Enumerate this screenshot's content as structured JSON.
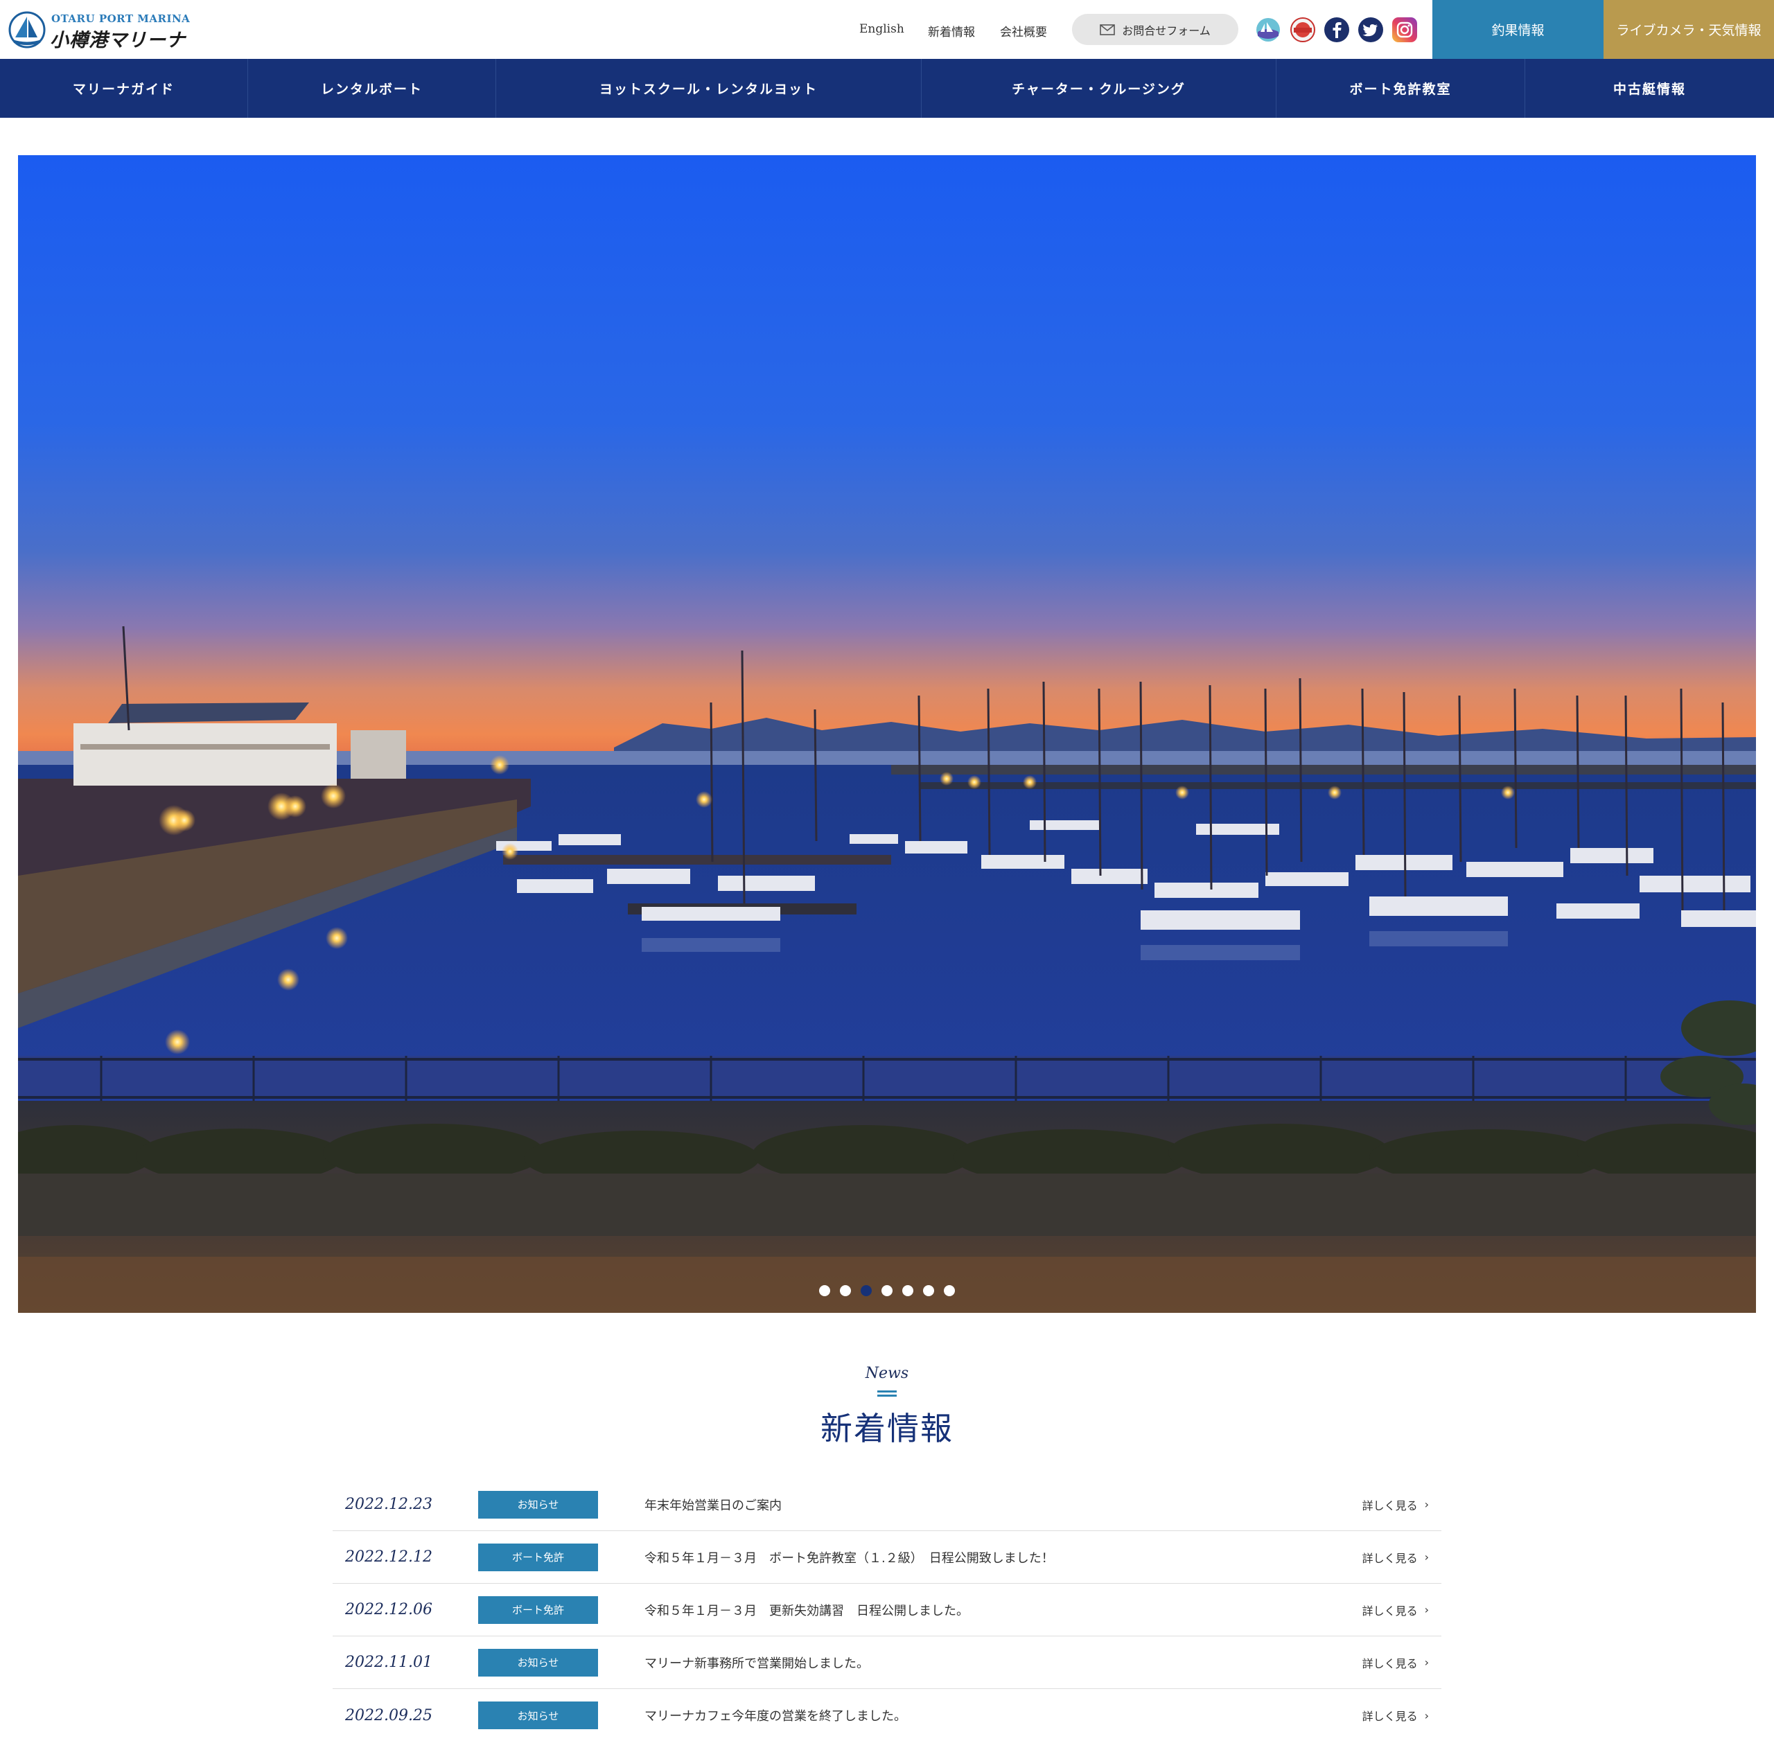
{
  "logo": {
    "en": "OTARU PORT MARINA",
    "jp": "小樽港マリーナ"
  },
  "util": {
    "english": "English",
    "news": "新着情報",
    "company": "会社概要",
    "contact": "お問合せフォーム"
  },
  "sns": [
    "marina-emblem-icon",
    "seal-logo-icon",
    "facebook-icon",
    "twitter-icon",
    "instagram-icon"
  ],
  "header_buttons": {
    "fishing": "釣果情報",
    "camera": "ライブカメラ・天気情報"
  },
  "nav": [
    "マリーナガイド",
    "レンタルボート",
    "ヨットスクール・レンタルヨット",
    "チャーター・クルージング",
    "ボート免許教室",
    "中古艇情報"
  ],
  "hero": {
    "slide_count": 7,
    "active_slide": 3
  },
  "news": {
    "label_en": "News",
    "title": "新着情報",
    "more_label": "詳しく見る",
    "items": [
      {
        "date": "2022.12.23",
        "category": "お知らせ",
        "text": "年末年始営業日のご案内"
      },
      {
        "date": "2022.12.12",
        "category": "ボート免許",
        "text": "令和５年１月－３月　ボート免許教室（１.２級）　日程公開致しました！"
      },
      {
        "date": "2022.12.06",
        "category": "ボート免許",
        "text": "令和５年１月－３月　更新失効講習　日程公開しました。"
      },
      {
        "date": "2022.11.01",
        "category": "お知らせ",
        "text": "マリーナ新事務所で営業開始しました。"
      },
      {
        "date": "2022.09.25",
        "category": "お知らせ",
        "text": "マリーナカフェ今年度の営業を終了しました。"
      }
    ]
  },
  "colors": {
    "navy": "#163178",
    "teal": "#2a82b2",
    "gold": "#b99a4e"
  }
}
